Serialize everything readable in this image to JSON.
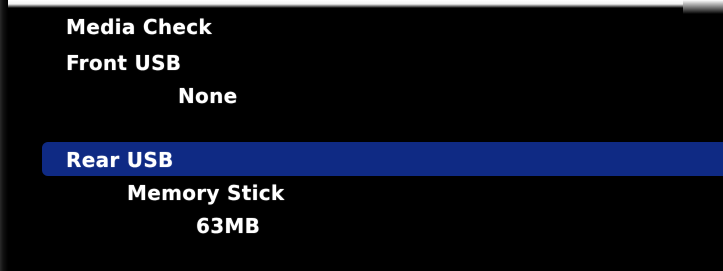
{
  "menu": {
    "title": "Media Check",
    "front_usb": {
      "label": "Front USB",
      "value": "None"
    },
    "rear_usb": {
      "label": "Rear USB",
      "device": "Memory Stick",
      "size": "63MB"
    }
  },
  "colors": {
    "background": "#000000",
    "text": "#ffffff",
    "selection_highlight": "#0f2a84"
  }
}
